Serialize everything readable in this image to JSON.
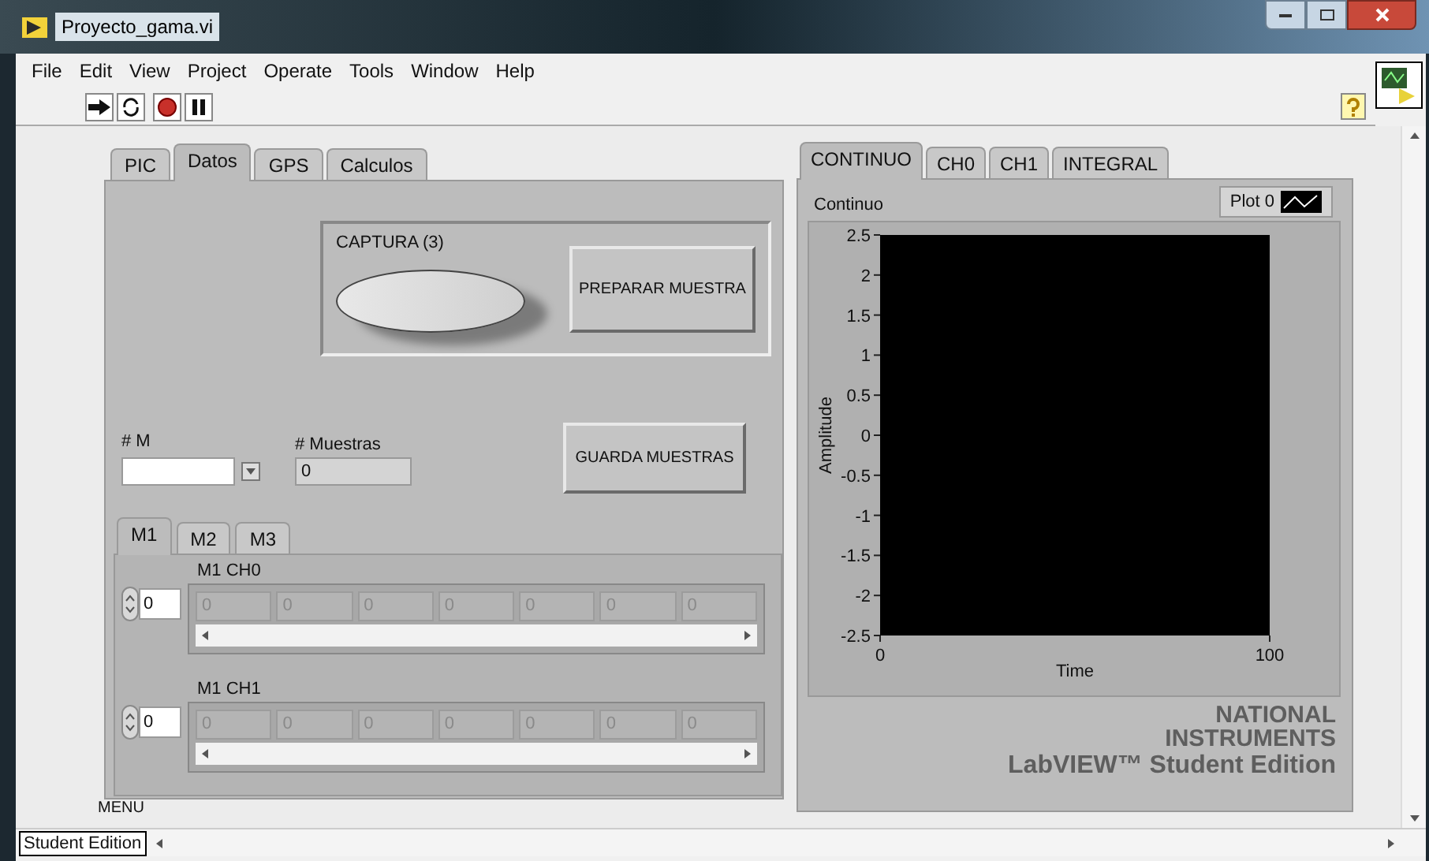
{
  "window": {
    "title": "Proyecto_gama.vi"
  },
  "menu": [
    "File",
    "Edit",
    "View",
    "Project",
    "Operate",
    "Tools",
    "Window",
    "Help"
  ],
  "left_tabs": [
    {
      "label": "PIC",
      "selected": false
    },
    {
      "label": "Datos",
      "selected": true
    },
    {
      "label": "GPS",
      "selected": false
    },
    {
      "label": "Calculos",
      "selected": false
    }
  ],
  "datos": {
    "captura": {
      "label": "CAPTURA (3)",
      "on": false
    },
    "preparar_button": "PREPARAR MUESTRA",
    "m_field": {
      "label": "# M"
    },
    "muestras_field": {
      "label": "# Muestras",
      "value": "0"
    },
    "guarda_button": "GUARDA MUESTRAS",
    "sub_tabs": [
      {
        "label": "M1",
        "selected": true
      },
      {
        "label": "M2",
        "selected": false
      },
      {
        "label": "M3",
        "selected": false
      }
    ],
    "arrays": [
      {
        "label": "M1 CH0",
        "index": "0",
        "cells": [
          "0",
          "0",
          "0",
          "0",
          "0",
          "0",
          "0"
        ]
      },
      {
        "label": "M1 CH1",
        "index": "0",
        "cells": [
          "0",
          "0",
          "0",
          "0",
          "0",
          "0",
          "0"
        ]
      }
    ],
    "menu_label": "MENU"
  },
  "right_tabs": [
    {
      "label": "CONTINUO",
      "selected": true
    },
    {
      "label": "CH0",
      "selected": false
    },
    {
      "label": "CH1",
      "selected": false
    },
    {
      "label": "INTEGRAL",
      "selected": false
    }
  ],
  "graph": {
    "title": "Continuo",
    "legend": "Plot 0",
    "xlabel": "Time",
    "ylabel": "Amplitude",
    "xticks": [
      "0",
      "100"
    ],
    "yticks": [
      "2.5",
      "2",
      "1.5",
      "1",
      "0.5",
      "0",
      "-0.5",
      "-1",
      "-1.5",
      "-2",
      "-2.5"
    ]
  },
  "watermark": {
    "brand": [
      "NATIONAL",
      "INSTRUMENTS"
    ],
    "product": "LabVIEW™ Student Edition"
  },
  "status_bar": {
    "label": "Student Edition"
  }
}
